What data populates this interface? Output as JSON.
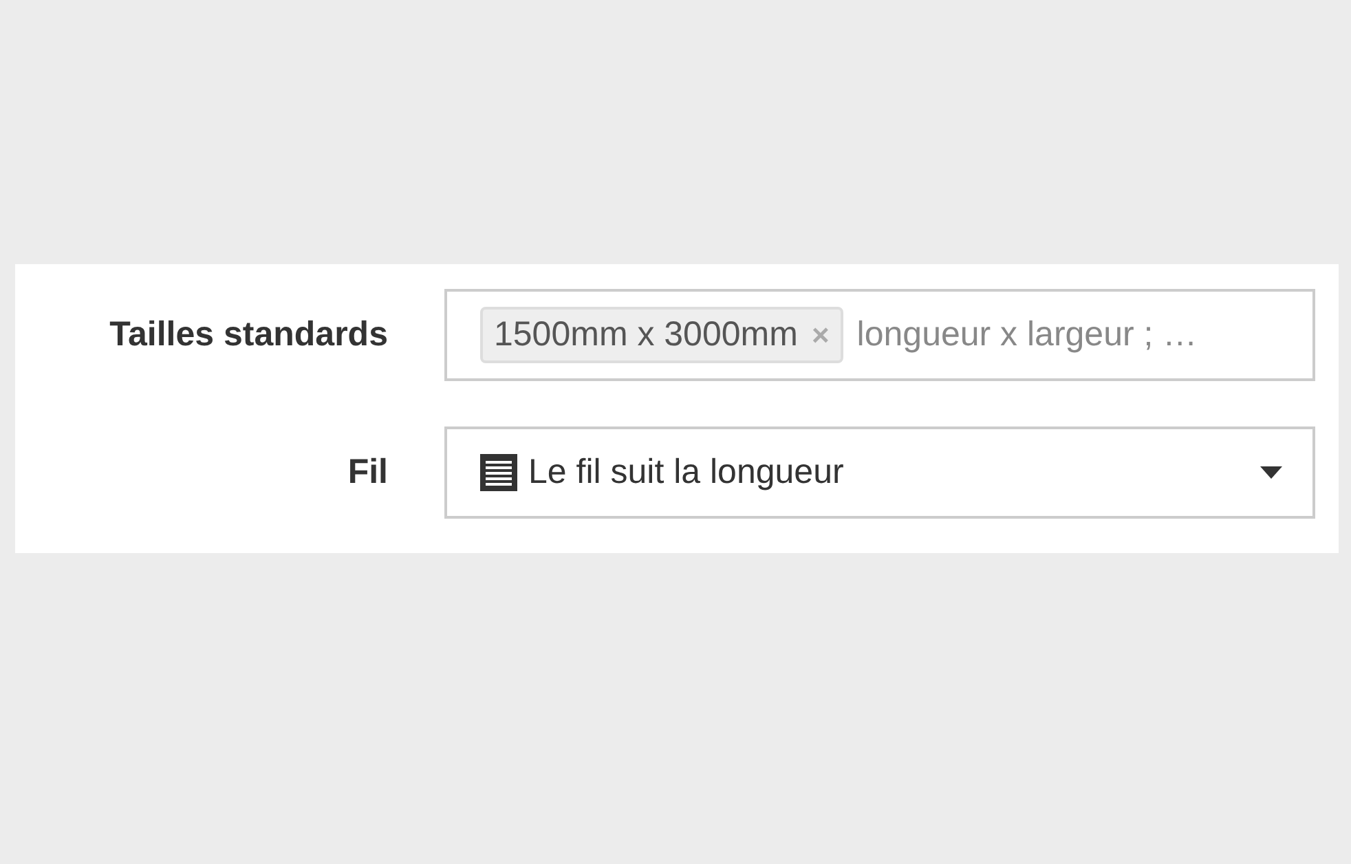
{
  "form": {
    "rows": [
      {
        "kind": "tags",
        "label": "Tailles standards",
        "tags": [
          {
            "text": "1500mm x 3000mm",
            "remove": "×"
          }
        ],
        "placeholder": "longueur x largeur ; …"
      },
      {
        "kind": "select",
        "label": "Fil",
        "value": "Le fil suit la longueur"
      }
    ]
  }
}
